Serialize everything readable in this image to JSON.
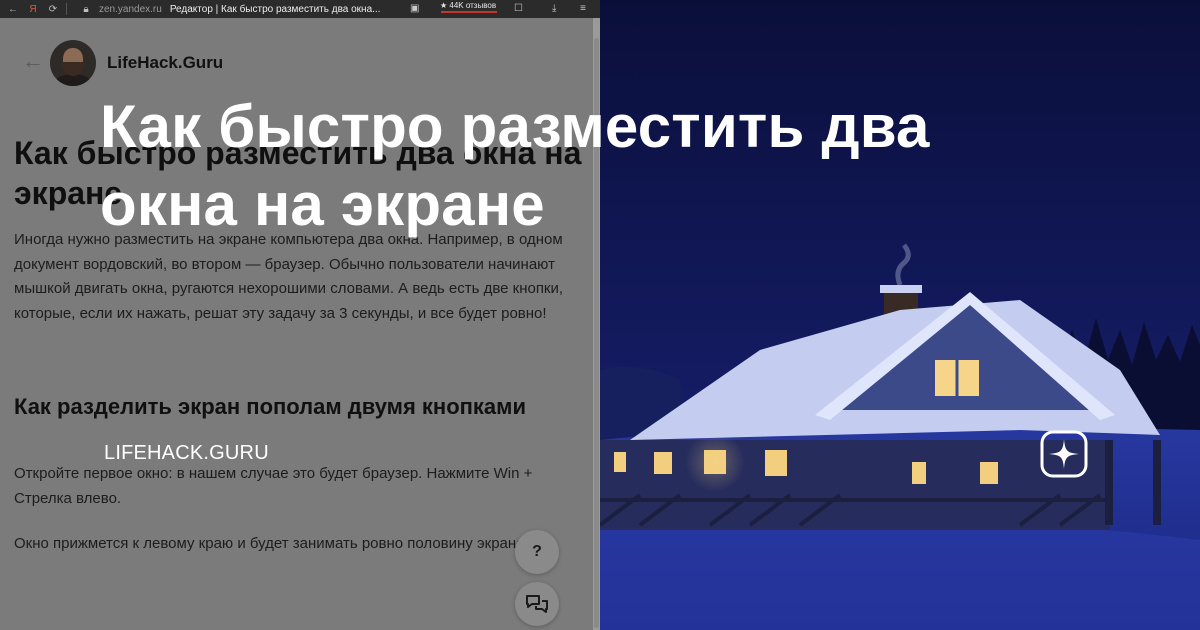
{
  "browser": {
    "url": "zen.yandex.ru",
    "tab_title": "Редактор | Как быстро разместить два окна...",
    "rating_badge": "★ 44K отзывов"
  },
  "article": {
    "channel_name": "LifeHack.Guru",
    "title": "Как быстро разместить два окна на экране",
    "intro": "Иногда нужно разместить на экране компьютера два окна. Например, в одном документ вордовский, во втором — браузер. Обычно пользователи начинают мышкой двигать окна, ругаются нехорошими словами. А ведь есть две кнопки, которые, если их нажать, решат эту задачу за 3 секунды, и все будет ровно!",
    "section_heading": "Как разделить экран пополам двумя кнопками",
    "step1": "Откройте первое окно: в нашем случае это будет браузер. Нажмите Win + Стрелка влево.",
    "step2": "Окно прижмется к левому краю и будет занимать ровно половину экрана.",
    "help_label": "?"
  },
  "overlay": {
    "title": "Как быстро разместить два окна на экране",
    "site": "LIFEHACK.GURU"
  },
  "colors": {
    "sky": "#0c1240",
    "snow": "#2a3aa0",
    "text": "#ffffff"
  },
  "icons": [
    "back-arrow-icon",
    "help-icon",
    "chat-icon",
    "zen-logo-icon"
  ]
}
